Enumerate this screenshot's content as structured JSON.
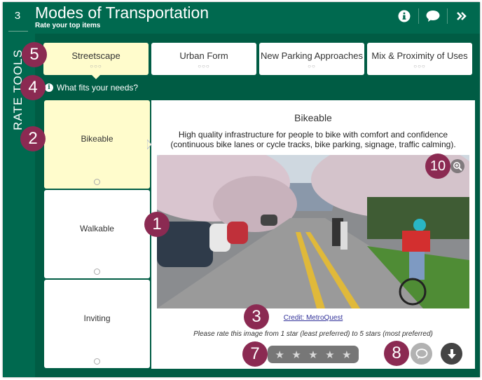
{
  "header": {
    "step_number": "3",
    "title": "Modes of Transportation",
    "subtitle": "Rate your top items",
    "icons": [
      "info-icon",
      "comment-icon",
      "double-chevron-right-icon"
    ]
  },
  "sidebar": {
    "label": "RATE TOOLS"
  },
  "tabs": [
    {
      "label": "Streetscape",
      "dots": "○○○",
      "active": true
    },
    {
      "label": "Urban Form",
      "dots": "○○○",
      "active": false
    },
    {
      "label": "New Parking Approaches",
      "dots": "○○",
      "active": false
    },
    {
      "label": "Mix & Proximity of Uses",
      "dots": "○○○",
      "active": false
    }
  ],
  "prompt": {
    "text": "What fits your needs?"
  },
  "items": [
    {
      "label": "Bikeable",
      "active": true
    },
    {
      "label": "Walkable",
      "active": false
    },
    {
      "label": "Inviting",
      "active": false
    }
  ],
  "detail": {
    "title": "Bikeable",
    "description": "High quality infrastructure for people to bike with comfort and confidence (continuous bike lanes or cycle tracks, bike parking, signage, traffic calming).",
    "photo_alt": "Tree-lined residential street with cherry blossoms, parked cars, and cyclists riding in a painted bike lane",
    "credit": "Credit: MetroQuest",
    "instruction": "Please rate this image from 1 star (least preferred) to 5 stars (most preferred)",
    "rating": {
      "value": 0,
      "max": 5
    }
  },
  "annotations": [
    {
      "label": "1"
    },
    {
      "label": "2"
    },
    {
      "label": "3"
    },
    {
      "label": "4"
    },
    {
      "label": "5"
    },
    {
      "label": "7"
    },
    {
      "label": "8"
    },
    {
      "label": "10"
    }
  ],
  "colors": {
    "brand_green": "#00694f",
    "active_yellow": "#fffccc",
    "badge": "#8b2a52"
  }
}
